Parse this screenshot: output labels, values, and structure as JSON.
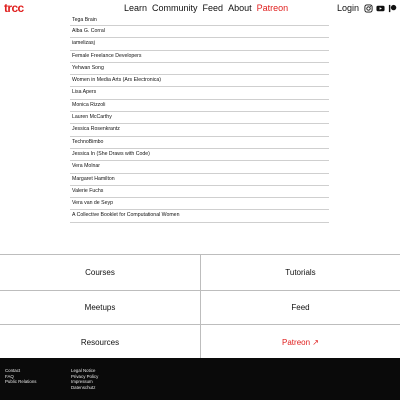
{
  "header": {
    "logo": "trcc",
    "nav": [
      {
        "label": "Learn"
      },
      {
        "label": "Community"
      },
      {
        "label": "Feed"
      },
      {
        "label": "About"
      },
      {
        "label": "Patreon"
      }
    ],
    "login": "Login",
    "social_icons": [
      "instagram-icon",
      "youtube-icon",
      "patreon-icon"
    ],
    "accent_color": "#e0201f"
  },
  "list": [
    "Tega Brain",
    "Alba G. Corral",
    "iamelizasj",
    "Female Freelance Developers",
    "Yehwan Song",
    "Women in Media Arts (Ars Electronica)",
    "Lisa Apers",
    "Monica Rizzoli",
    "Lauren McCarthy",
    "Jessica Rosenkrantz",
    "TechnoBimbo",
    "Jessica In (She Draws with Code)",
    "Vera Molnar",
    "Margaret Hamilton",
    "Valerie Fuchs",
    "Vera van de Seyp",
    "A Collective Booklet for Computational Women"
  ],
  "grid": [
    {
      "label": "Courses"
    },
    {
      "label": "Tutorials"
    },
    {
      "label": "Meetups"
    },
    {
      "label": "Feed"
    },
    {
      "label": "Resources"
    },
    {
      "label": "Patreon ↗"
    }
  ],
  "footer": {
    "col1": [
      "Contact",
      "FAQ",
      "Public Relations"
    ],
    "col2": [
      "Legal Notice",
      "Privacy Policy",
      "Impressum",
      "Datenschutz"
    ]
  }
}
